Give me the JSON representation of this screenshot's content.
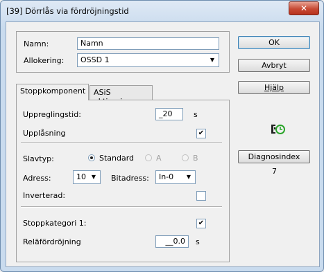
{
  "window": {
    "title": "[39] Dörrlås via fördröjningstid",
    "close_glyph": "✕"
  },
  "general": {
    "name_label": "Namn:",
    "name_value": "Namn",
    "alloc_label": "Allokering:",
    "alloc_value": "OSSD 1"
  },
  "tabs": [
    {
      "label": "Stoppkomponent"
    },
    {
      "label": "ASiS aktivering"
    }
  ],
  "stop": {
    "uppreg_label": "Uppreglingstid:",
    "uppreg_value": "_20",
    "uppreg_unit": "s",
    "unlock_label": "Upplåsning",
    "unlock_checked": "✔",
    "slav_label": "Slavtyp:",
    "slav_standard": "Standard",
    "slav_a": "A",
    "slav_b": "B",
    "adress_label": "Adress:",
    "adress_value": "10",
    "bitadress_label": "Bitadress:",
    "bitadress_value": "In-0",
    "inverted_label": "Inverterad:",
    "stopcat_label": "Stoppkategori 1:",
    "stopcat_checked": "✔",
    "relay_label": "Reläfördröjning",
    "relay_value": "__0.0",
    "relay_unit": "s"
  },
  "buttons": {
    "ok": "OK",
    "cancel": "Avbryt",
    "help": "Hjälp",
    "diag": "Diagnosindex",
    "diag_value": "7"
  },
  "colors": {
    "accent_green": "#2aa52a",
    "close_red": "#c74a34"
  },
  "icons": {
    "status": "key-timer-icon",
    "dropdown": "chevron-down-icon"
  }
}
